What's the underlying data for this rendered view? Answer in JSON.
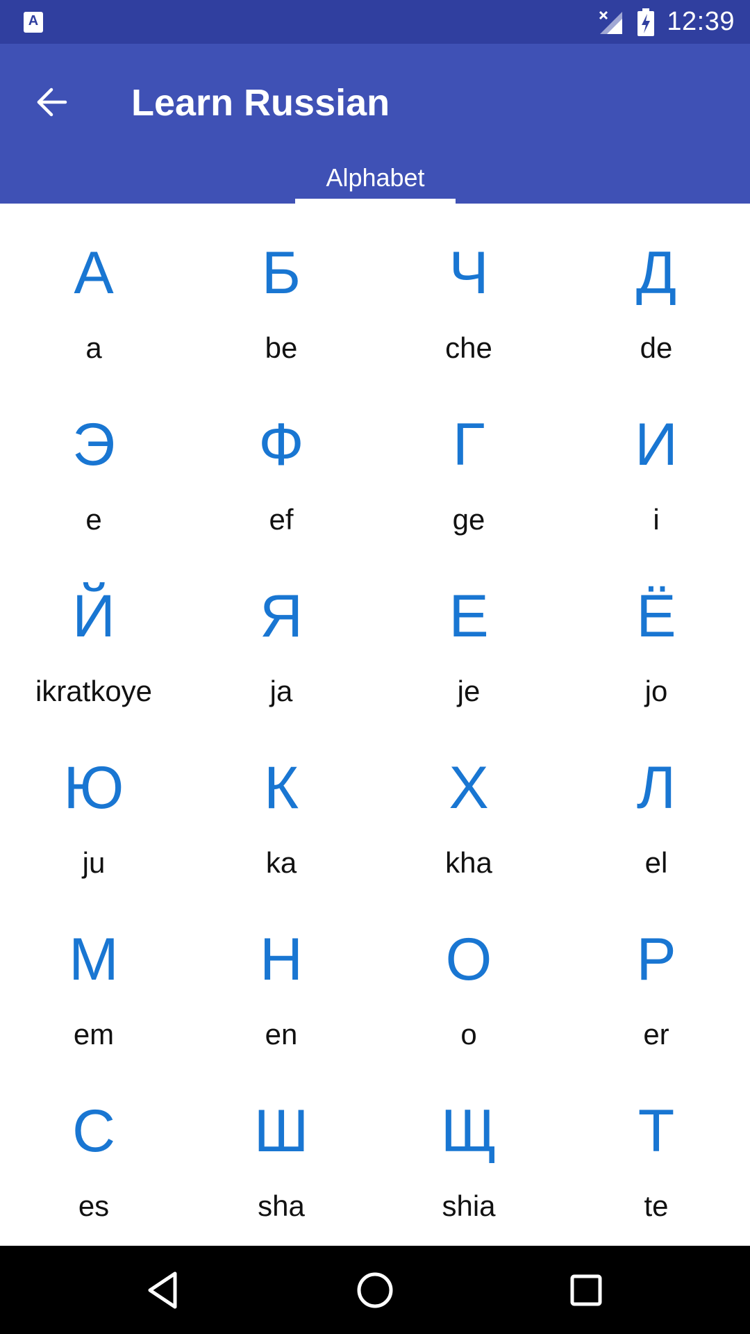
{
  "status_bar": {
    "app_icon_glyph": "A",
    "time": "12:39",
    "icons": [
      "app-notification-icon",
      "signal-off-icon",
      "battery-charging-icon"
    ]
  },
  "app_bar": {
    "title": "Learn Russian",
    "back_icon": "arrow-back-icon",
    "color": "#3f51b5",
    "status_color": "#303f9f"
  },
  "tabs": [
    {
      "label": "Alphabet",
      "selected": true
    }
  ],
  "letters": [
    {
      "letter": "А",
      "name": "a"
    },
    {
      "letter": "Б",
      "name": "be"
    },
    {
      "letter": "Ч",
      "name": "che"
    },
    {
      "letter": "Д",
      "name": "de"
    },
    {
      "letter": "Э",
      "name": "e"
    },
    {
      "letter": "Ф",
      "name": "ef"
    },
    {
      "letter": "Г",
      "name": "ge"
    },
    {
      "letter": "И",
      "name": "i"
    },
    {
      "letter": "Й",
      "name": "ikratkoye"
    },
    {
      "letter": "Я",
      "name": "ja"
    },
    {
      "letter": "Е",
      "name": "je"
    },
    {
      "letter": "Ё",
      "name": "jo"
    },
    {
      "letter": "Ю",
      "name": "ju"
    },
    {
      "letter": "К",
      "name": "ka"
    },
    {
      "letter": "Х",
      "name": "kha"
    },
    {
      "letter": "Л",
      "name": "el"
    },
    {
      "letter": "М",
      "name": "em"
    },
    {
      "letter": "Н",
      "name": "en"
    },
    {
      "letter": "О",
      "name": "o"
    },
    {
      "letter": "Р",
      "name": "er"
    },
    {
      "letter": "С",
      "name": "es"
    },
    {
      "letter": "Ш",
      "name": "sha"
    },
    {
      "letter": "Щ",
      "name": "shia"
    },
    {
      "letter": "Т",
      "name": "te"
    }
  ],
  "colors": {
    "letter": "#1976d2",
    "name": "#111111"
  },
  "nav_bar": {
    "icons": [
      "back-triangle-icon",
      "home-circle-icon",
      "recents-square-icon"
    ]
  }
}
